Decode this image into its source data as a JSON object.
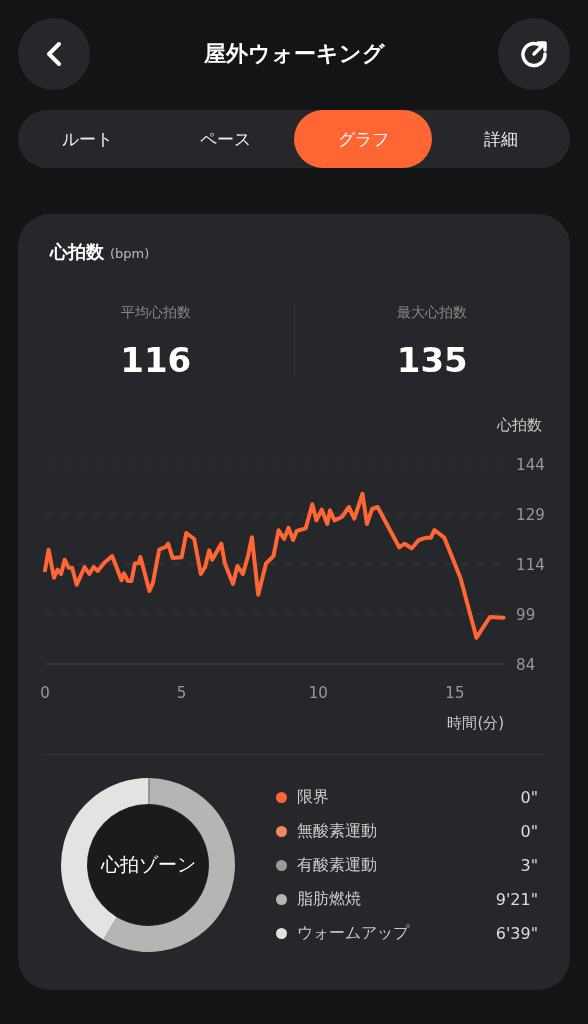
{
  "header": {
    "title": "屋外ウォーキング"
  },
  "tabs": [
    {
      "label": "ルート",
      "selected": false
    },
    {
      "label": "ペース",
      "selected": false
    },
    {
      "label": "グラフ",
      "selected": true
    },
    {
      "label": "詳細",
      "selected": false
    }
  ],
  "heart_rate": {
    "title": "心拍数",
    "unit": "(bpm)",
    "stats": [
      {
        "label": "平均心拍数",
        "value": "116"
      },
      {
        "label": "最大心拍数",
        "value": "135"
      }
    ],
    "chart_data": {
      "type": "line",
      "ylabel": "心拍数",
      "xlabel": "時間(分)",
      "xlim": [
        0,
        16.8
      ],
      "ylim": [
        84,
        144
      ],
      "xticks": [
        0,
        5,
        10,
        15
      ],
      "yticks": [
        84,
        99,
        114,
        129,
        144
      ],
      "grid": true,
      "x": [
        0,
        0.13,
        0.33,
        0.46,
        0.59,
        0.72,
        0.86,
        0.99,
        1.16,
        1.45,
        1.62,
        1.78,
        1.93,
        2.17,
        2.46,
        2.8,
        2.89,
        3.03,
        3.16,
        3.29,
        3.42,
        3.49,
        3.82,
        3.95,
        4.18,
        4.41,
        4.51,
        4.67,
        5.0,
        5.17,
        5.46,
        5.7,
        5.86,
        6.01,
        6.12,
        6.45,
        6.58,
        6.88,
        7.04,
        7.24,
        7.43,
        7.57,
        7.8,
        8.09,
        8.36,
        8.55,
        8.75,
        8.91,
        9.08,
        9.21,
        9.54,
        9.78,
        9.93,
        10.13,
        10.33,
        10.43,
        10.59,
        10.86,
        11.12,
        11.32,
        11.62,
        11.78,
        11.97,
        12.17,
        12.96,
        13.16,
        13.42,
        13.68,
        13.95,
        14.12,
        14.25,
        14.61,
        15.2,
        15.79,
        16.28,
        16.78
      ],
      "series": [
        {
          "color": "#ff6633",
          "values": [
            112.1,
            118.3,
            109.9,
            112.3,
            111.0,
            115.3,
            112.9,
            112.9,
            107.8,
            113.1,
            111.0,
            113.1,
            111.9,
            114.4,
            116.4,
            109.1,
            111.2,
            108.9,
            108.9,
            114.2,
            114.2,
            116.1,
            105.9,
            108.3,
            118.3,
            119.1,
            120.1,
            115.8,
            116.0,
            123.3,
            121.5,
            111.0,
            113.1,
            118.1,
            115.3,
            120.1,
            114.2,
            108.0,
            113.4,
            111.0,
            116.4,
            122.0,
            104.8,
            114.2,
            116.4,
            124.1,
            121.5,
            124.9,
            121.2,
            123.9,
            124.7,
            131.9,
            127.1,
            130.3,
            126.0,
            130.1,
            127.1,
            128.1,
            131.1,
            127.6,
            135.1,
            126.0,
            130.5,
            131.1,
            119.0,
            120.1,
            118.7,
            121.2,
            121.9,
            121.9,
            124.2,
            121.9,
            109.9,
            91.9,
            98.1,
            97.9
          ]
        }
      ]
    }
  },
  "zones": {
    "center_label": "心拍ゾーン",
    "chart_data": {
      "type": "donut",
      "values": [
        0,
        0,
        0.31,
        58.26,
        41.43
      ]
    },
    "items": [
      {
        "name": "限界",
        "duration": "0\"",
        "color": "#ff6633"
      },
      {
        "name": "無酸素運動",
        "duration": "0\"",
        "color": "#f2875f"
      },
      {
        "name": "有酸素運動",
        "duration": "3\"",
        "color": "#9a9a9a"
      },
      {
        "name": "脂肪燃焼",
        "duration": "9'21\"",
        "color": "#b5b5b5"
      },
      {
        "name": "ウォームアップ",
        "duration": "6'39\"",
        "color": "#e3e3e3"
      }
    ]
  }
}
